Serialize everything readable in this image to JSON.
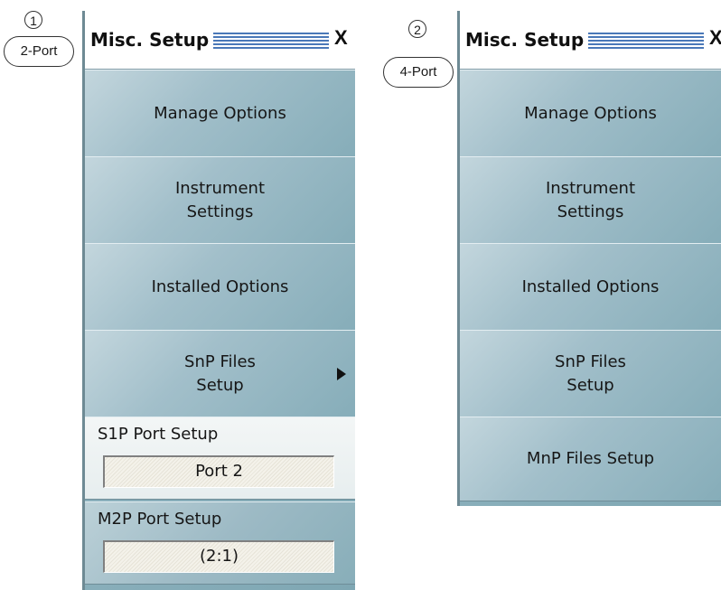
{
  "callouts": [
    {
      "number": "1",
      "label": "2-Port"
    },
    {
      "number": "2",
      "label": "4-Port"
    }
  ],
  "panel_2port": {
    "title": "Misc. Setup",
    "close": "X",
    "buttons": [
      {
        "label": "Manage Options"
      },
      {
        "label": "Instrument\nSettings"
      },
      {
        "label": "Installed Options"
      },
      {
        "label": "SnP Files\nSetup",
        "submenu": true
      }
    ],
    "s1p": {
      "label": "S1P Port Setup",
      "value": "Port 2"
    },
    "m2p": {
      "label": "M2P Port Setup",
      "value": "(2:1)"
    }
  },
  "panel_4port": {
    "title": "Misc. Setup",
    "close": "X",
    "buttons": [
      {
        "label": "Manage Options"
      },
      {
        "label": "Instrument\nSettings"
      },
      {
        "label": "Installed Options"
      },
      {
        "label": "SnP Files\nSetup"
      },
      {
        "label": "MnP Files Setup"
      }
    ]
  }
}
